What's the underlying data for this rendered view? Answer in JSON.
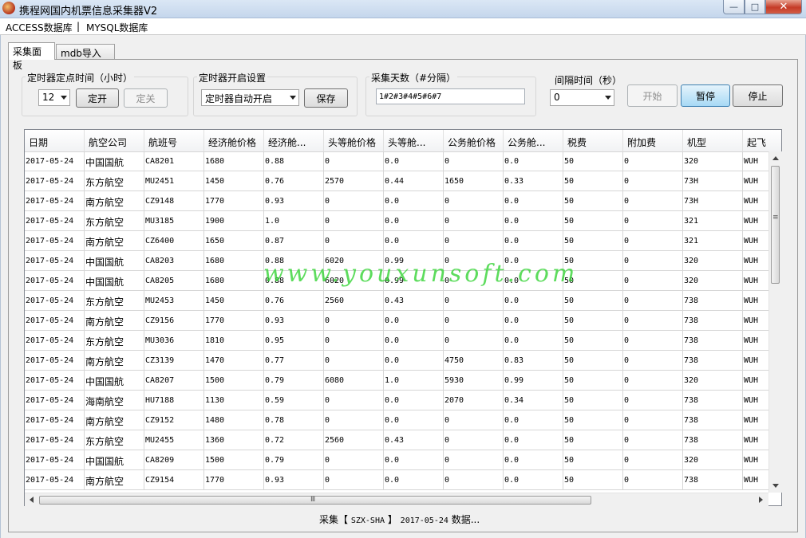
{
  "window": {
    "title": "携程网国内机票信息采集器V2",
    "minimize_glyph": "—",
    "maximize_glyph": "□",
    "close_glyph": "✕"
  },
  "menu": {
    "access": "ACCESS数据库",
    "separator": "|",
    "mysql": "MYSQL数据库"
  },
  "tabs": {
    "active": "采集面板",
    "inactive": "mdb导入数据"
  },
  "timer_time": {
    "label": "定时器定点时间（小时）",
    "hour_value": "12",
    "open_button": "定开",
    "close_button": "定关"
  },
  "timer_setting": {
    "label": "定时器开启设置",
    "mode_value": "定时器自动开启",
    "save_button": "保存"
  },
  "collect_days": {
    "label": "采集天数（#分隔）",
    "value": "1#2#3#4#5#6#7"
  },
  "interval": {
    "label": "间隔时间（秒）",
    "value": "0"
  },
  "actions": {
    "start": "开始",
    "pause": "暂停",
    "stop": "停止"
  },
  "grid": {
    "columns": [
      "日期",
      "航空公司",
      "航班号",
      "经济舱价格",
      "经济舱...",
      "头等舱价格",
      "头等舱...",
      "公务舱价格",
      "公务舱...",
      "税费",
      "附加费",
      "机型",
      "起飞"
    ],
    "rows": [
      [
        "2017-05-24",
        "中国国航",
        "CA8201",
        "1680",
        "0.88",
        "0",
        "0.0",
        "0",
        "0.0",
        "50",
        "0",
        "320",
        "WUH"
      ],
      [
        "2017-05-24",
        "东方航空",
        "MU2451",
        "1450",
        "0.76",
        "2570",
        "0.44",
        "1650",
        "0.33",
        "50",
        "0",
        "73H",
        "WUH"
      ],
      [
        "2017-05-24",
        "南方航空",
        "CZ9148",
        "1770",
        "0.93",
        "0",
        "0.0",
        "0",
        "0.0",
        "50",
        "0",
        "73H",
        "WUH"
      ],
      [
        "2017-05-24",
        "东方航空",
        "MU3185",
        "1900",
        "1.0",
        "0",
        "0.0",
        "0",
        "0.0",
        "50",
        "0",
        "321",
        "WUH"
      ],
      [
        "2017-05-24",
        "南方航空",
        "CZ6400",
        "1650",
        "0.87",
        "0",
        "0.0",
        "0",
        "0.0",
        "50",
        "0",
        "321",
        "WUH"
      ],
      [
        "2017-05-24",
        "中国国航",
        "CA8203",
        "1680",
        "0.88",
        "6020",
        "0.99",
        "0",
        "0.0",
        "50",
        "0",
        "320",
        "WUH"
      ],
      [
        "2017-05-24",
        "中国国航",
        "CA8205",
        "1680",
        "0.88",
        "6020",
        "0.99",
        "0",
        "0.0",
        "50",
        "0",
        "320",
        "WUH"
      ],
      [
        "2017-05-24",
        "东方航空",
        "MU2453",
        "1450",
        "0.76",
        "2560",
        "0.43",
        "0",
        "0.0",
        "50",
        "0",
        "738",
        "WUH"
      ],
      [
        "2017-05-24",
        "南方航空",
        "CZ9156",
        "1770",
        "0.93",
        "0",
        "0.0",
        "0",
        "0.0",
        "50",
        "0",
        "738",
        "WUH"
      ],
      [
        "2017-05-24",
        "东方航空",
        "MU3036",
        "1810",
        "0.95",
        "0",
        "0.0",
        "0",
        "0.0",
        "50",
        "0",
        "738",
        "WUH"
      ],
      [
        "2017-05-24",
        "南方航空",
        "CZ3139",
        "1470",
        "0.77",
        "0",
        "0.0",
        "4750",
        "0.83",
        "50",
        "0",
        "738",
        "WUH"
      ],
      [
        "2017-05-24",
        "中国国航",
        "CA8207",
        "1500",
        "0.79",
        "6080",
        "1.0",
        "5930",
        "0.99",
        "50",
        "0",
        "320",
        "WUH"
      ],
      [
        "2017-05-24",
        "海南航空",
        "HU7188",
        "1130",
        "0.59",
        "0",
        "0.0",
        "2070",
        "0.34",
        "50",
        "0",
        "738",
        "WUH"
      ],
      [
        "2017-05-24",
        "南方航空",
        "CZ9152",
        "1480",
        "0.78",
        "0",
        "0.0",
        "0",
        "0.0",
        "50",
        "0",
        "738",
        "WUH"
      ],
      [
        "2017-05-24",
        "东方航空",
        "MU2455",
        "1360",
        "0.72",
        "2560",
        "0.43",
        "0",
        "0.0",
        "50",
        "0",
        "738",
        "WUH"
      ],
      [
        "2017-05-24",
        "中国国航",
        "CA8209",
        "1500",
        "0.79",
        "0",
        "0.0",
        "0",
        "0.0",
        "50",
        "0",
        "320",
        "WUH"
      ],
      [
        "2017-05-24",
        "南方航空",
        "CZ9154",
        "1770",
        "0.93",
        "0",
        "0.0",
        "0",
        "0.0",
        "50",
        "0",
        "738",
        "WUH"
      ]
    ]
  },
  "scrollbar": {
    "vgrip": "≡",
    "hgrip": "Ⅲ"
  },
  "watermark": "www.youxunsoft.com",
  "status": {
    "prefix": "采集【",
    "route": "SZX-SHA",
    "suffix": "】",
    "date": "2017-05-24",
    "tail": "数据..."
  }
}
